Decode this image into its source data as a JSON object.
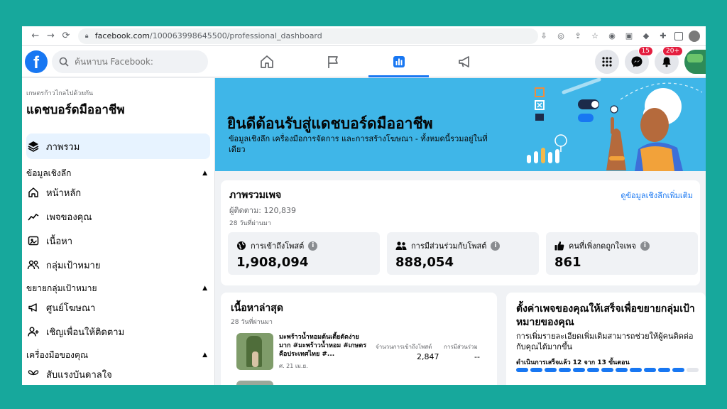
{
  "browser": {
    "url_host": "facebook.com",
    "url_path": "/100063998645500/professional_dashboard"
  },
  "fb_top": {
    "search_placeholder": "ค้นหาบน Facebook:",
    "nav": [
      "home-icon",
      "flag-icon",
      "insights-icon",
      "megaphone-icon"
    ],
    "active_nav": 2,
    "messenger_badge": "15",
    "notifications_badge": "20+"
  },
  "sidebar": {
    "subtitle": "เกษตรก้าวไกลไปด้วยกัน",
    "title": "แดชบอร์ดมืออาชีพ",
    "active_item": "ภาพรวม",
    "sections": [
      {
        "label": "ข้อมูลเชิงลึก",
        "items": [
          "หน้าหลัก",
          "เพจของคุณ",
          "เนื้อหา",
          "กลุ่มเป้าหมาย"
        ]
      },
      {
        "label": "ขยายกลุ่มเป้าหมาย",
        "items": [
          "ศูนย์โฆษณา",
          "เชิญเพื่อนให้ติดตาม"
        ]
      },
      {
        "label": "เครื่องมือของคุณ",
        "items": [
          "สับแรงบันดาลใจ"
        ]
      }
    ]
  },
  "banner": {
    "title": "ยินดีต้อนรับสู่แดชบอร์ดมืออาชีพ",
    "description": "ข้อมูลเชิงลึก เครื่องมือการจัดการ และการสร้างโฆษณา - ทั้งหมดนี้รวมอยู่ในที่เดียว"
  },
  "overview": {
    "title": "ภาพรวมเพจ",
    "link": "ดูข้อมูลเชิงลึกเพิ่มเติม",
    "followers": "ผู้ติดตาม: 120,839",
    "period": "28 วันที่ผ่านมา",
    "stats": [
      {
        "label": "การเข้าถึงโพสต์",
        "value": "1,908,094",
        "icon": "globe-icon"
      },
      {
        "label": "การมีส่วนร่วมกับโพสต์",
        "value": "888,054",
        "icon": "people-icon"
      },
      {
        "label": "คนที่เพิ่งกดถูกใจเพจ",
        "value": "861",
        "icon": "thumbs-up-icon"
      }
    ]
  },
  "content": {
    "title": "เนื้อหาล่าสุด",
    "period": "28 วันที่ผ่านมา",
    "post_text": "มะพร้าวน้ำหอมต้นเตี้ยตัดง่ายมาก #มะพร้าวน้ำหอม #เกษตรคือประเทศไทย #...",
    "post_date": "ศ. 21 เม.ย.",
    "col_reach": "จำนวนการเข้าถึงโพสต์",
    "col_engagement": "การมีส่วนร่วม",
    "reach_value": "2,847",
    "engagement_value": "--"
  },
  "setup": {
    "title": "ตั้งค่าเพจของคุณให้เสร็จเพื่อขยายกลุ่มเป้าหมายของคุณ",
    "description": "การเพิ่มรายละเอียดเพิ่มเติมสามารถช่วยให้ผู้คนติดต่อกับคุณได้มากขึ้น",
    "progress": "ดำเนินการเสร็จแล้ว 12 จาก 13 ขั้นตอน",
    "steps_done": 12,
    "steps_total": 13
  },
  "colors": {
    "accent": "#1877f2",
    "banner": "#3fb6e8",
    "background": "#17a89c"
  }
}
